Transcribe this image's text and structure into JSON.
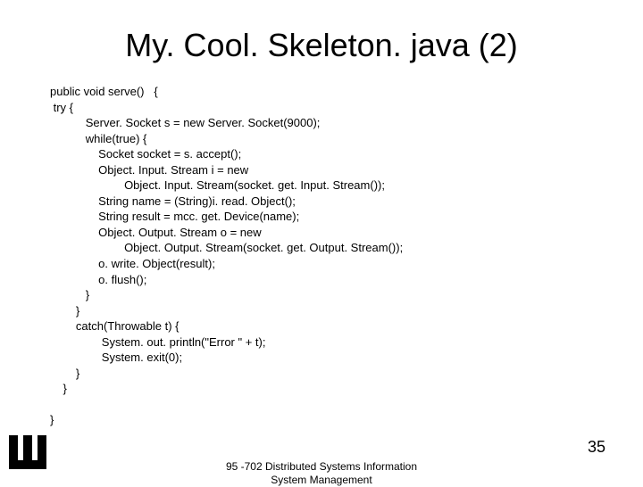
{
  "title": "My. Cool. Skeleton. java (2)",
  "code": "public void serve()   {\n try {\n           Server. Socket s = new Server. Socket(9000);\n           while(true) {\n               Socket socket = s. accept();\n               Object. Input. Stream i = new\n                       Object. Input. Stream(socket. get. Input. Stream());\n               String name = (String)i. read. Object();\n               String result = mcc. get. Device(name);\n               Object. Output. Stream o = new\n                       Object. Output. Stream(socket. get. Output. Stream());\n               o. write. Object(result);\n               o. flush();\n           }\n        }\n        catch(Throwable t) {\n                System. out. println(\"Error \" + t);\n                System. exit(0);\n        }\n    }\n\n}",
  "footer": {
    "center_line1": "95 -702 Distributed Systems Information",
    "center_line2": "System Management",
    "page_number": "35"
  }
}
